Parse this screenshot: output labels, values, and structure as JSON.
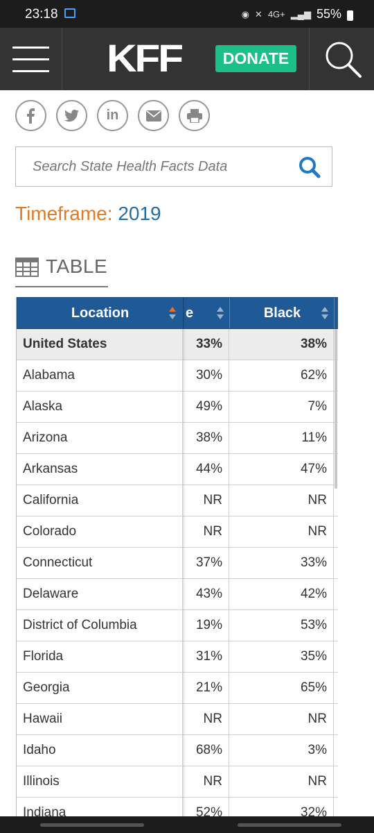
{
  "status_bar": {
    "time": "23:18",
    "network": "4G+",
    "battery": "55%"
  },
  "header": {
    "logo": "KFF",
    "donate_label": "DONATE",
    "colors": {
      "background": "#333333",
      "donate": "#1cbf8a"
    }
  },
  "share": {
    "icons": [
      "facebook-icon",
      "twitter-icon",
      "linkedin-icon",
      "email-icon",
      "print-icon"
    ],
    "linkedin_label": "in"
  },
  "search": {
    "placeholder": "Search State Health Facts Data"
  },
  "timeframe": {
    "label": "Timeframe:",
    "value": "2019"
  },
  "tabs": {
    "table_label": "TABLE"
  },
  "table": {
    "columns": [
      "Location",
      "e",
      "Black"
    ],
    "header_color": "#1f5a96",
    "rows": [
      {
        "location": "United States",
        "e": "33%",
        "black": "38%"
      },
      {
        "location": "Alabama",
        "e": "30%",
        "black": "62%"
      },
      {
        "location": "Alaska",
        "e": "49%",
        "black": "7%"
      },
      {
        "location": "Arizona",
        "e": "38%",
        "black": "11%"
      },
      {
        "location": "Arkansas",
        "e": "44%",
        "black": "47%"
      },
      {
        "location": "California",
        "e": "NR",
        "black": "NR"
      },
      {
        "location": "Colorado",
        "e": "NR",
        "black": "NR"
      },
      {
        "location": "Connecticut",
        "e": "37%",
        "black": "33%"
      },
      {
        "location": "Delaware",
        "e": "43%",
        "black": "42%"
      },
      {
        "location": "District of Columbia",
        "e": "19%",
        "black": "53%"
      },
      {
        "location": "Florida",
        "e": "31%",
        "black": "35%"
      },
      {
        "location": "Georgia",
        "e": "21%",
        "black": "65%"
      },
      {
        "location": "Hawaii",
        "e": "NR",
        "black": "NR"
      },
      {
        "location": "Idaho",
        "e": "68%",
        "black": "3%"
      },
      {
        "location": "Illinois",
        "e": "NR",
        "black": "NR"
      },
      {
        "location": "Indiana",
        "e": "52%",
        "black": "32%"
      }
    ]
  }
}
